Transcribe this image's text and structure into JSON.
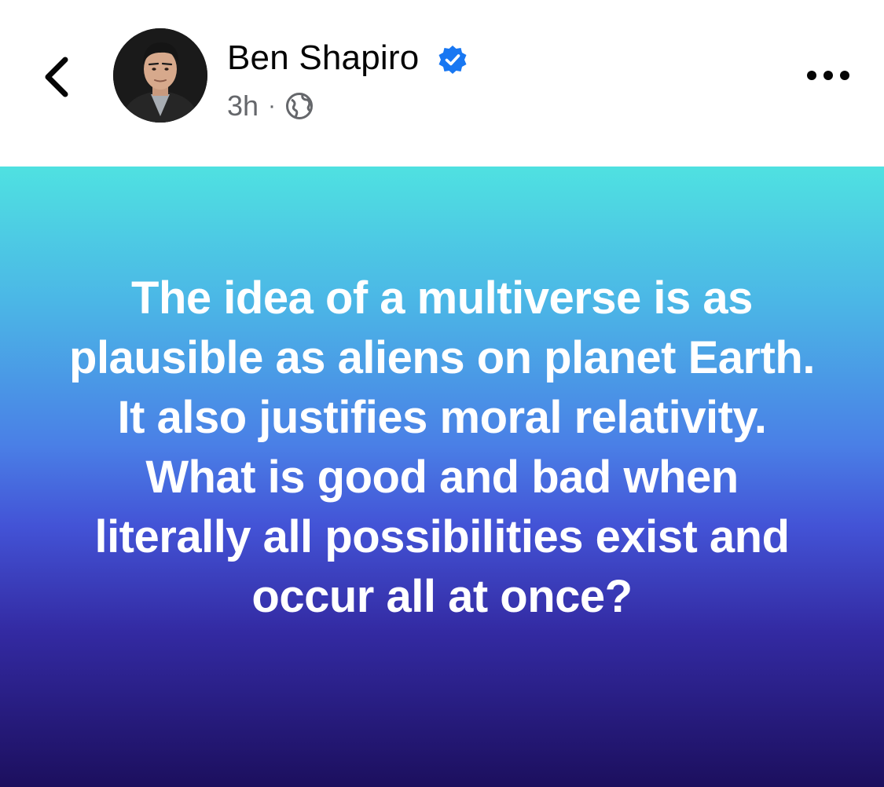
{
  "header": {
    "author_name": "Ben Shapiro",
    "timestamp": "3h",
    "separator": "·",
    "privacy_icon": "globe-icon",
    "verified_icon": "verified-badge-icon",
    "back_icon": "chevron-left-icon",
    "more_icon": "more-horizontal-icon",
    "accent_color": "#1877f2"
  },
  "post": {
    "text": "The idea of a multiverse is as plausible as aliens on planet Earth. It also justifies moral relativity. What is good and bad when literally all possibilities exist and occur all at once?",
    "background_top_color": "#4fe1e1",
    "background_bottom_color": "#1c0f5e",
    "text_color": "#ffffff"
  }
}
